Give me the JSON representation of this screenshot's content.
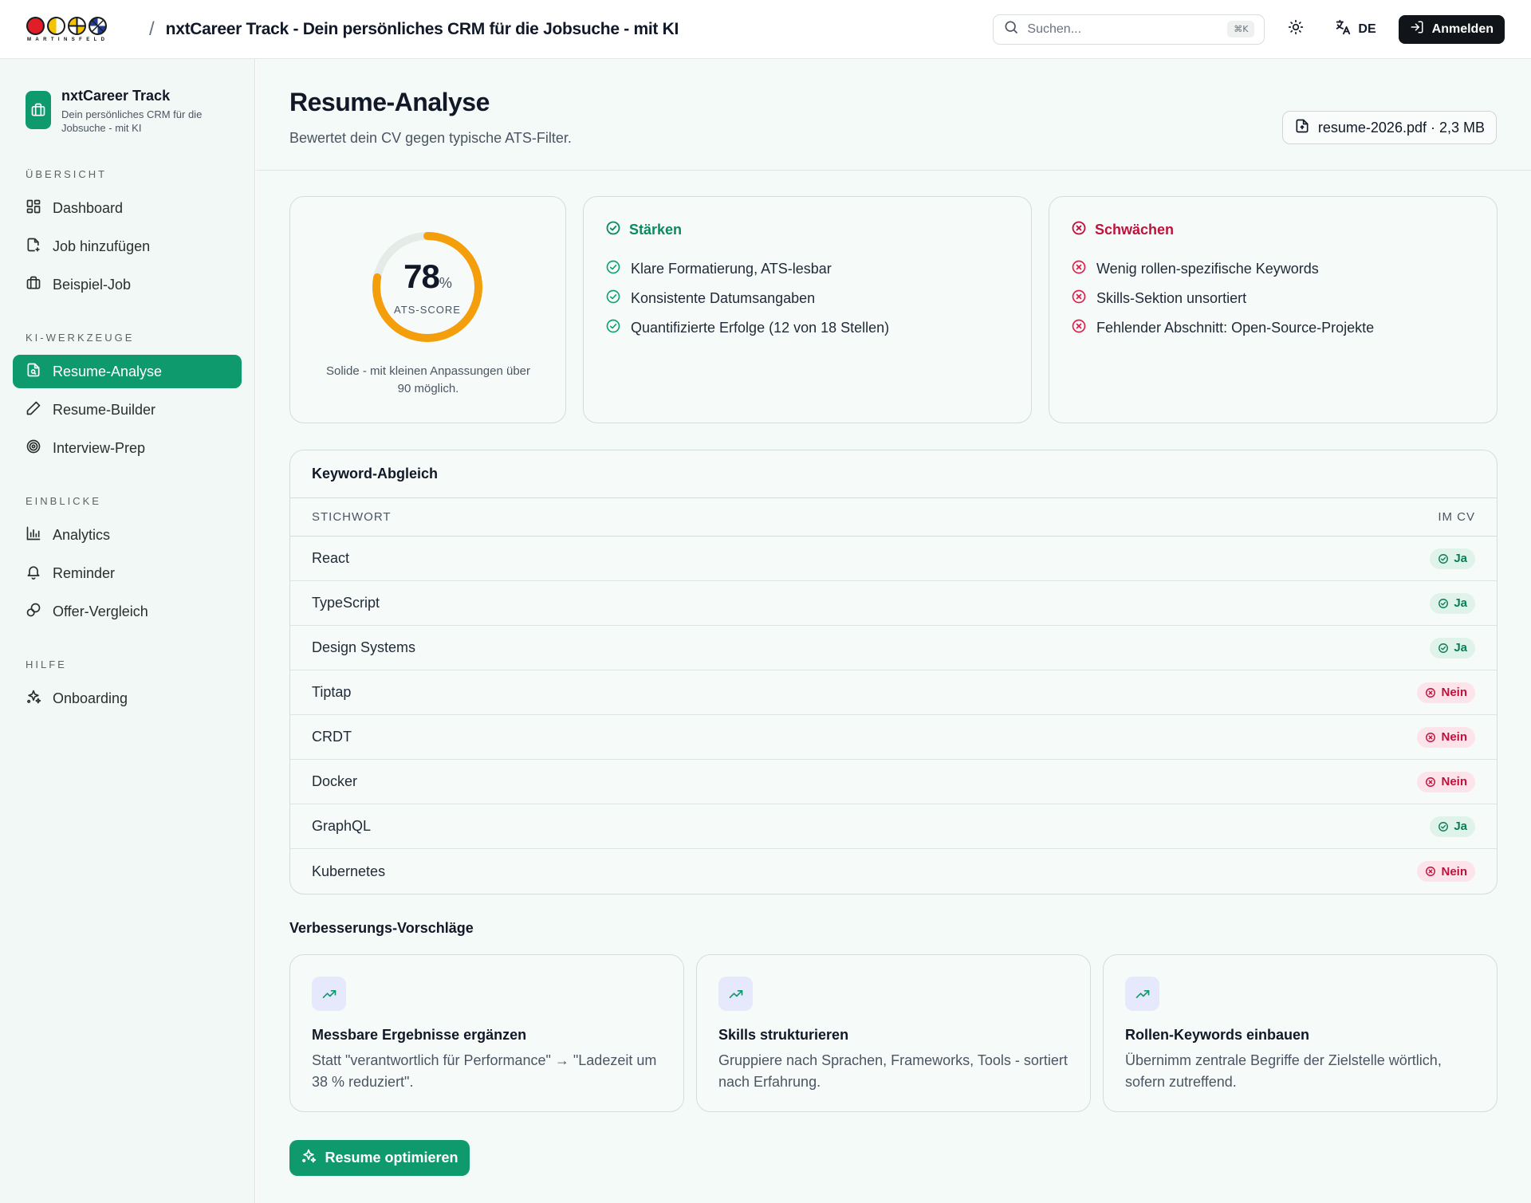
{
  "header": {
    "logo_text": "MARTINSFELD",
    "separator": "/",
    "app_title": "nxtCareer Track - Dein persönliches CRM für die Jobsuche - mit KI",
    "search_placeholder": "Suchen...",
    "search_shortcut": "⌘K",
    "language": "DE",
    "login_label": "Anmelden"
  },
  "sidebar": {
    "brand_name": "nxtCareer Track",
    "brand_sub": "Dein persönliches CRM für die Jobsuche - mit KI",
    "sections": [
      {
        "heading": "ÜBERSICHT",
        "items": [
          "Dashboard",
          "Job hinzufügen",
          "Beispiel-Job"
        ]
      },
      {
        "heading": "KI-WERKZEUGE",
        "items": [
          "Resume-Analyse",
          "Resume-Builder",
          "Interview-Prep"
        ]
      },
      {
        "heading": "EINBLICKE",
        "items": [
          "Analytics",
          "Reminder",
          "Offer-Vergleich"
        ]
      },
      {
        "heading": "HILFE",
        "items": [
          "Onboarding"
        ]
      }
    ]
  },
  "page": {
    "title": "Resume-Analyse",
    "subtitle": "Bewertet dein CV gegen typische ATS-Filter.",
    "file_chip": "resume-2026.pdf · 2,3 MB"
  },
  "score": {
    "value": "78",
    "unit": "%",
    "fraction": 0.78,
    "label": "ATS-SCORE",
    "description": "Solide - mit kleinen Anpassungen über 90 möglich."
  },
  "strengths": {
    "title": "Stärken",
    "items": [
      "Klare Formatierung, ATS-lesbar",
      "Konsistente Datumsangaben",
      "Quantifizierte Erfolge (12 von 18 Stellen)"
    ]
  },
  "weaknesses": {
    "title": "Schwächen",
    "items": [
      "Wenig rollen-spezifische Keywords",
      "Skills-Sektion unsortiert",
      "Fehlender Abschnitt: Open-Source-Projekte"
    ]
  },
  "keywords": {
    "title": "Keyword-Abgleich",
    "col_keyword": "STICHWORT",
    "col_in_cv": "IM CV",
    "rows": [
      {
        "keyword": "React",
        "status": "Ja"
      },
      {
        "keyword": "TypeScript",
        "status": "Ja"
      },
      {
        "keyword": "Design Systems",
        "status": "Ja"
      },
      {
        "keyword": "Tiptap",
        "status": "Nein"
      },
      {
        "keyword": "CRDT",
        "status": "Nein"
      },
      {
        "keyword": "Docker",
        "status": "Nein"
      },
      {
        "keyword": "GraphQL",
        "status": "Ja"
      },
      {
        "keyword": "Kubernetes",
        "status": "Nein"
      }
    ]
  },
  "suggestions": {
    "title": "Verbesserungs-Vorschläge",
    "cards": [
      {
        "title": "Messbare Ergebnisse ergänzen",
        "text": "Statt \"verantwortlich für Performance\" → \"Ladezeit um 38 % reduziert\"."
      },
      {
        "title": "Skills strukturieren",
        "text": "Gruppiere nach Sprachen, Frameworks, Tools - sortiert nach Erfahrung."
      },
      {
        "title": "Rollen-Keywords einbauen",
        "text": "Übernimm zentrale Begriffe der Zielstelle wörtlich, sofern zutreffend."
      }
    ]
  },
  "cta_label": "Resume optimieren",
  "colors": {
    "accent": "#0f9a6d",
    "ring": "#f59e0b",
    "positive": "#0a8a5f",
    "negative": "#be123c"
  }
}
